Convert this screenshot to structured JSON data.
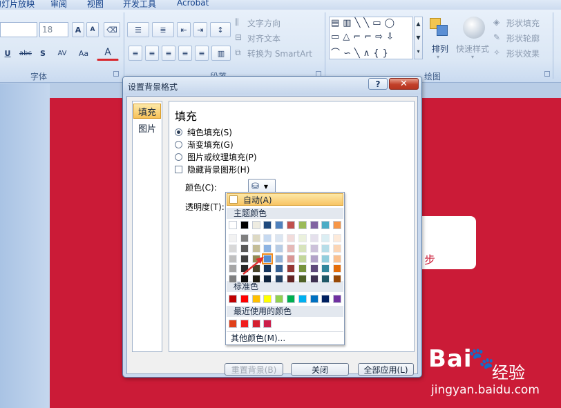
{
  "ribbon": {
    "tabs": [
      "幻灯片放映",
      "审阅",
      "视图",
      "开发工具",
      "Acrobat"
    ],
    "font_size_value": "18",
    "buttons": {
      "grow_font": "A",
      "shrink_font": "A",
      "underline": "U",
      "strike": "abc",
      "shadow": "S",
      "spacing": "AV",
      "case": "Aa",
      "font_color": "A"
    },
    "paragraph_commands": [
      "文字方向",
      "对齐文本",
      "转换为 SmartArt"
    ],
    "arrange_label": "排列",
    "quick_styles_label": "快速样式",
    "shape_commands": [
      "形状填充",
      "形状轮廓",
      "形状效果"
    ],
    "group_labels": {
      "font": "字体",
      "paragraph": "段落",
      "drawing": "绘图"
    }
  },
  "slide": {
    "card_text": "步",
    "background": "#cb1b37"
  },
  "dialog": {
    "title": "设置背景格式",
    "help": "?",
    "close": "✕",
    "categories": [
      "填充",
      "图片"
    ],
    "heading": "填充",
    "options": {
      "solid": "纯色填充(S)",
      "gradient": "渐变填充(G)",
      "picture": "图片或纹理填充(P)",
      "hide": "隐藏背景图形(H)"
    },
    "color_label": "颜色(C):",
    "transparency_label": "透明度(T):",
    "buttons": {
      "reset": "重置背景(B)",
      "close": "关闭",
      "apply_all": "全部应用(L)"
    }
  },
  "palette": {
    "auto": "自动(A)",
    "theme_header": "主题颜色",
    "standard_header": "标准色",
    "recent_header": "最近使用的颜色",
    "more": "其他颜色(M)...",
    "theme_base": [
      "#ffffff",
      "#000000",
      "#eeece1",
      "#1f497d",
      "#4f81bd",
      "#c0504d",
      "#9bbb59",
      "#8064a2",
      "#4bacc6",
      "#f79646"
    ],
    "theme_shades": [
      [
        "#f2f2f2",
        "#d8d8d8",
        "#bfbfbf",
        "#a5a5a5",
        "#7f7f7f"
      ],
      [
        "#7f7f7f",
        "#595959",
        "#3f3f3f",
        "#262626",
        "#0c0c0c"
      ],
      [
        "#ddd9c3",
        "#c4bd97",
        "#938953",
        "#494429",
        "#1d1b10"
      ],
      [
        "#c6d9f0",
        "#8db3e2",
        "#548dd4",
        "#17365d",
        "#0f243e"
      ],
      [
        "#dbe5f1",
        "#b8cce4",
        "#95b3d7",
        "#366092",
        "#244061"
      ],
      [
        "#f2dcdb",
        "#e5b9b7",
        "#d99694",
        "#953734",
        "#632423"
      ],
      [
        "#ebf1dd",
        "#d7e3bc",
        "#c3d69b",
        "#76923c",
        "#4f6128"
      ],
      [
        "#e5e0ec",
        "#ccc1d9",
        "#b2a2c7",
        "#5f497a",
        "#3f3151"
      ],
      [
        "#dbeef3",
        "#b7dde8",
        "#92cddc",
        "#31859b",
        "#205867"
      ],
      [
        "#fdeada",
        "#fbd5b5",
        "#fac08f",
        "#e36c09",
        "#974806"
      ]
    ],
    "standard": [
      "#c00000",
      "#ff0000",
      "#ffc000",
      "#ffff00",
      "#92d050",
      "#00b050",
      "#00b0f0",
      "#0070c0",
      "#002060",
      "#7030a0"
    ],
    "recent": [
      "#e0401a",
      "#f01e1e",
      "#d42030",
      "#cc1f4a"
    ],
    "highlight": {
      "column": 3,
      "row": 2
    },
    "pointer_color": "#e03030"
  },
  "watermark": {
    "brand": "Bai",
    "sub": "经验",
    "url": "jingyan.baidu.com"
  }
}
